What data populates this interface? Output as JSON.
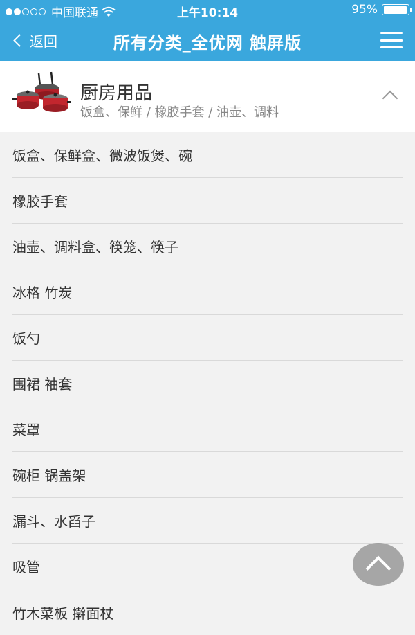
{
  "status_bar": {
    "carrier": "中国联通",
    "time": "上午10:14",
    "battery": "95%",
    "battery_level": 0.95,
    "signal": {
      "filled": 2,
      "total": 5
    },
    "icons": [
      "signal-dots-icon",
      "wifi-icon",
      "battery-icon"
    ]
  },
  "nav": {
    "back_label": "返回",
    "title": "所有分类_全优网 触屏版",
    "menu_icon": "hamburger-menu-icon"
  },
  "category": {
    "title": "厨房用品",
    "subtitle": "饭盒、保鲜 / 橡胶手套 / 油壶、调料",
    "image_icon": "cookware-pots-image",
    "toggle_icon": "chevron-up-icon"
  },
  "items": [
    {
      "label": "饭盒、保鲜盒、微波饭煲、碗"
    },
    {
      "label": "橡胶手套"
    },
    {
      "label": "油壶、调料盒、筷笼、筷子"
    },
    {
      "label": "冰格 竹炭"
    },
    {
      "label": "饭勺"
    },
    {
      "label": "围裙 袖套"
    },
    {
      "label": "菜罩"
    },
    {
      "label": "碗柜 锅盖架"
    },
    {
      "label": "漏斗、水舀子"
    },
    {
      "label": "吸管"
    },
    {
      "label": "竹木菜板 擀面杖"
    }
  ],
  "scroll_top_icon": "scroll-to-top-icon",
  "colors": {
    "brand": "#3aa7dd",
    "background": "#f2f2f2",
    "text": "#333333",
    "subtext": "#888888"
  }
}
